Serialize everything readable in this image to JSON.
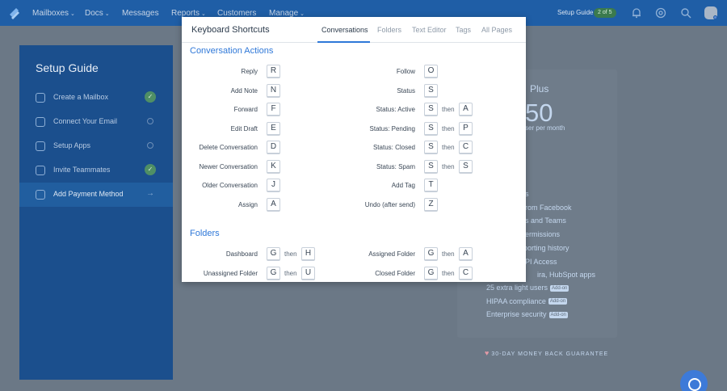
{
  "topnav": {
    "items": [
      {
        "label": "Mailboxes",
        "chevron": true
      },
      {
        "label": "Docs",
        "chevron": true
      },
      {
        "label": "Messages",
        "chevron": false
      },
      {
        "label": "Reports",
        "chevron": true
      },
      {
        "label": "Customers",
        "chevron": false
      },
      {
        "label": "Manage",
        "chevron": true
      }
    ],
    "setup_guide": "Setup Guide",
    "setup_badge": "2 of 5",
    "icons": [
      "bell-icon",
      "help-icon",
      "search-icon"
    ]
  },
  "setup_panel": {
    "title": "Setup Guide",
    "items": [
      {
        "label": "Create a Mailbox",
        "icon": "mailbox-icon",
        "status": "done"
      },
      {
        "label": "Connect Your Email",
        "icon": "email-icon",
        "status": "todo"
      },
      {
        "label": "Setup Apps",
        "icon": "apps-icon",
        "status": "todo"
      },
      {
        "label": "Invite Teammates",
        "icon": "teammates-icon",
        "status": "done"
      },
      {
        "label": "Add Payment Method",
        "icon": "card-icon",
        "status": "active"
      }
    ]
  },
  "plan": {
    "name": "Plus",
    "price": "50",
    "per": "ser per month",
    "features": [
      "s",
      "rom Facebook",
      "s and Teams",
      "ermissions",
      "porting history",
      "PI Access",
      "ira, HubSpot apps"
    ],
    "addons": [
      {
        "label": "25 extra light users",
        "badge": "Add-on"
      },
      {
        "label": "HIPAA compliance",
        "badge": "Add-on"
      },
      {
        "label": "Enterprise security",
        "badge": "Add-on"
      }
    ],
    "guarantee": "30-DAY MONEY BACK GUARANTEE"
  },
  "modal": {
    "title": "Keyboard Shortcuts",
    "tabs": [
      "Conversations",
      "Folders",
      "Text Editor",
      "Tags",
      "All Pages"
    ],
    "active_tab": "Conversations",
    "then_label": "then",
    "sections": {
      "conversation_actions": "Conversation Actions",
      "folders": "Folders"
    },
    "conversation_left": [
      {
        "label": "Reply",
        "keys": [
          "R"
        ]
      },
      {
        "label": "Add Note",
        "keys": [
          "N"
        ]
      },
      {
        "label": "Forward",
        "keys": [
          "F"
        ]
      },
      {
        "label": "Edit Draft",
        "keys": [
          "E"
        ]
      },
      {
        "label": "Delete Conversation",
        "keys": [
          "D"
        ]
      },
      {
        "label": "Newer Conversation",
        "keys": [
          "K"
        ]
      },
      {
        "label": "Older Conversation",
        "keys": [
          "J"
        ]
      },
      {
        "label": "Assign",
        "keys": [
          "A"
        ]
      }
    ],
    "conversation_right": [
      {
        "label": "Follow",
        "keys": [
          "O"
        ]
      },
      {
        "label": "Status",
        "keys": [
          "S"
        ]
      },
      {
        "label": "Status: Active",
        "keys": [
          "S",
          "A"
        ]
      },
      {
        "label": "Status: Pending",
        "keys": [
          "S",
          "P"
        ]
      },
      {
        "label": "Status: Closed",
        "keys": [
          "S",
          "C"
        ]
      },
      {
        "label": "Status: Spam",
        "keys": [
          "S",
          "S"
        ]
      },
      {
        "label": "Add Tag",
        "keys": [
          "T"
        ]
      },
      {
        "label": "Undo (after send)",
        "keys": [
          "Z"
        ]
      }
    ],
    "folders_left": [
      {
        "label": "Dashboard",
        "keys": [
          "G",
          "H"
        ]
      },
      {
        "label": "Unassigned Folder",
        "keys": [
          "G",
          "U"
        ]
      }
    ],
    "folders_right": [
      {
        "label": "Assigned Folder",
        "keys": [
          "G",
          "A"
        ]
      },
      {
        "label": "Closed Folder",
        "keys": [
          "G",
          "C"
        ]
      }
    ]
  }
}
